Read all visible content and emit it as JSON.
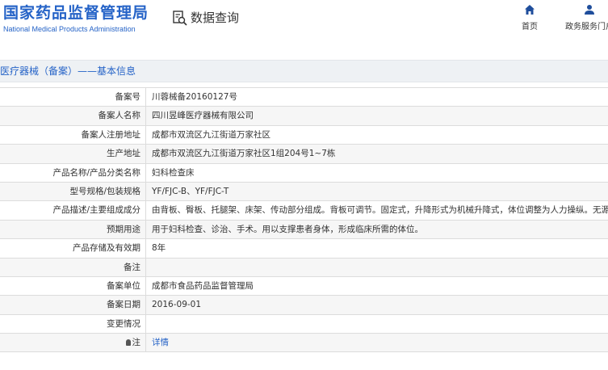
{
  "header": {
    "logo_cn": "国家药品监督管理局",
    "logo_en": "National Medical Products Administration",
    "query_label": "数据查询",
    "nav": [
      {
        "label": "首页",
        "icon": "home-icon"
      },
      {
        "label": "政务服务门户",
        "icon": "user-icon"
      }
    ]
  },
  "section_title": "医疗器械（备案）——基本信息",
  "rows": [
    {
      "label": "备案号",
      "value": "川蓉械备20160127号"
    },
    {
      "label": "备案人名称",
      "value": "四川昱峰医疗器械有限公司"
    },
    {
      "label": "备案人注册地址",
      "value": "成都市双流区九江街道万家社区"
    },
    {
      "label": "生产地址",
      "value": "成都市双流区九江街道万家社区1组204号1~7栋"
    },
    {
      "label": "产品名称/产品分类名称",
      "value": "妇科检查床"
    },
    {
      "label": "型号规格/包装规格",
      "value": "YF/FJC-B、YF/FJC-T"
    },
    {
      "label": "产品描述/主要组成成分",
      "value": "由背板、臀板、托腿架、床架、传动部分组成。背板可调节。固定式，升降形式为机械升降式，体位调整为人力操纵。无源产品。"
    },
    {
      "label": "预期用途",
      "value": "用于妇科检查、诊治、手术。用以支撑患者身体，形成临床所需的体位。"
    },
    {
      "label": "产品存储及有效期",
      "value": "8年"
    },
    {
      "label": "备注",
      "value": ""
    },
    {
      "label": "备案单位",
      "value": "成都市食品药品监督管理局"
    },
    {
      "label": "备案日期",
      "value": "2016-09-01"
    },
    {
      "label": "变更情况",
      "value": ""
    },
    {
      "label": "注",
      "value": "详情"
    }
  ],
  "colors": {
    "brand": "#2563c7",
    "row_alt": "#f6f6f6",
    "border": "#dcdcdc"
  }
}
